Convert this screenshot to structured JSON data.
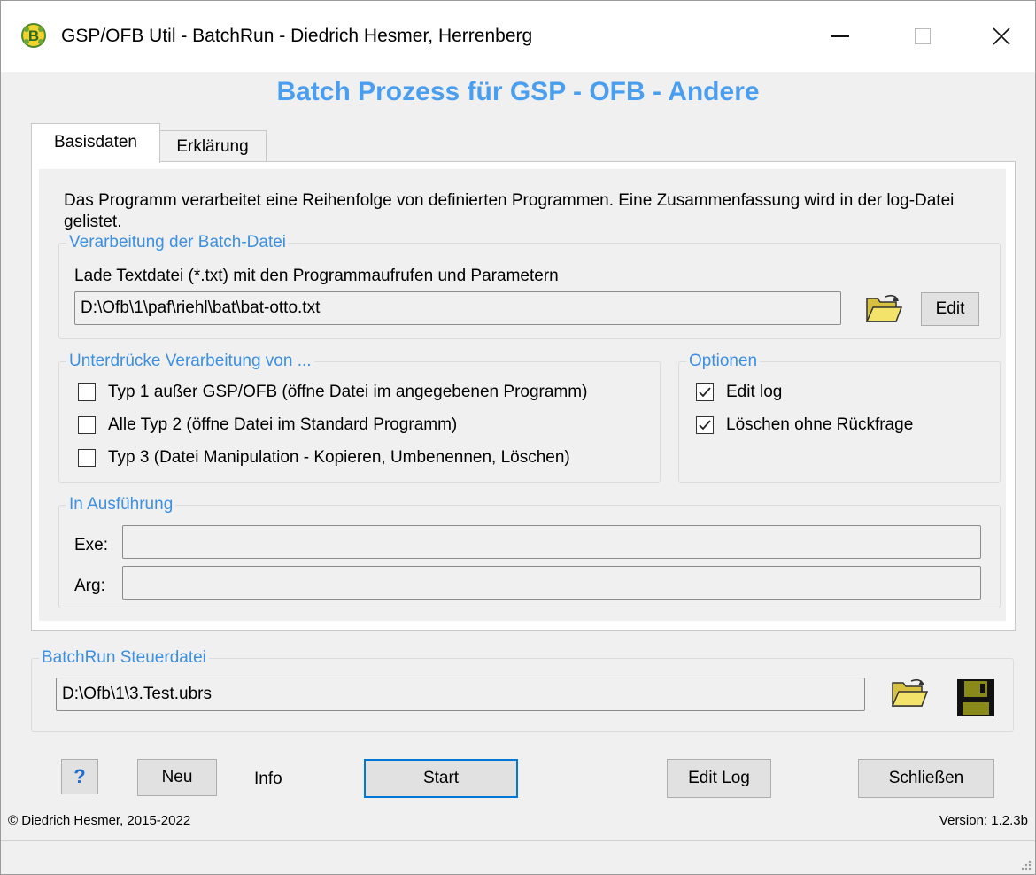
{
  "window": {
    "title": "GSP/OFB Util - BatchRun  -  Diedrich Hesmer, Herrenberg",
    "minimize_label": "—",
    "close_label": "✕"
  },
  "heading": "Batch Prozess für GSP - OFB - Andere",
  "tabs": [
    {
      "label": "Basisdaten",
      "active": true
    },
    {
      "label": "Erklärung",
      "active": false
    }
  ],
  "description": "Das Programm verarbeitet eine  Reihenfolge von definierten Programmen. Eine Zusammenfassung wird in der log-Datei gelistet.",
  "batch_file": {
    "legend": "Verarbeitung der Batch-Datei",
    "label": "Lade Textdatei (*.txt) mit den Programmaufrufen und Parametern",
    "path": "D:\\Ofb\\1\\paf\\riehl\\bat\\bat-otto.txt",
    "edit_label": "Edit"
  },
  "suppress": {
    "legend": "Unterdrücke Verarbeitung von ...",
    "items": [
      {
        "label": "Typ 1 außer GSP/OFB (öffne Datei im angegebenen Programm)",
        "checked": false
      },
      {
        "label": "Alle Typ 2 (öffne Datei im Standard Programm)",
        "checked": false
      },
      {
        "label": "Typ 3 (Datei Manipulation - Kopieren, Umbenennen, Löschen)",
        "checked": false
      }
    ]
  },
  "options": {
    "legend": "Optionen",
    "items": [
      {
        "label": "Edit log",
        "checked": true
      },
      {
        "label": "Löschen ohne Rückfrage",
        "checked": true
      }
    ]
  },
  "execution": {
    "legend": "In Ausführung",
    "exe_label": "Exe:",
    "exe_value": "",
    "arg_label": "Arg:",
    "arg_value": ""
  },
  "control_file": {
    "legend": "BatchRun Steuerdatei",
    "path": "D:\\Ofb\\1\\3.Test.ubrs"
  },
  "buttons": {
    "help": "?",
    "new": "Neu",
    "info": "Info",
    "start": "Start",
    "edit_log": "Edit Log",
    "close": "Schließen"
  },
  "footer": {
    "copyright": "© Diedrich Hesmer,  2015-2022",
    "version": "Version: 1.2.3b"
  },
  "colors": {
    "accent": "#4a9ef0",
    "legend": "#3d8fe0",
    "start_border": "#0078d7"
  }
}
